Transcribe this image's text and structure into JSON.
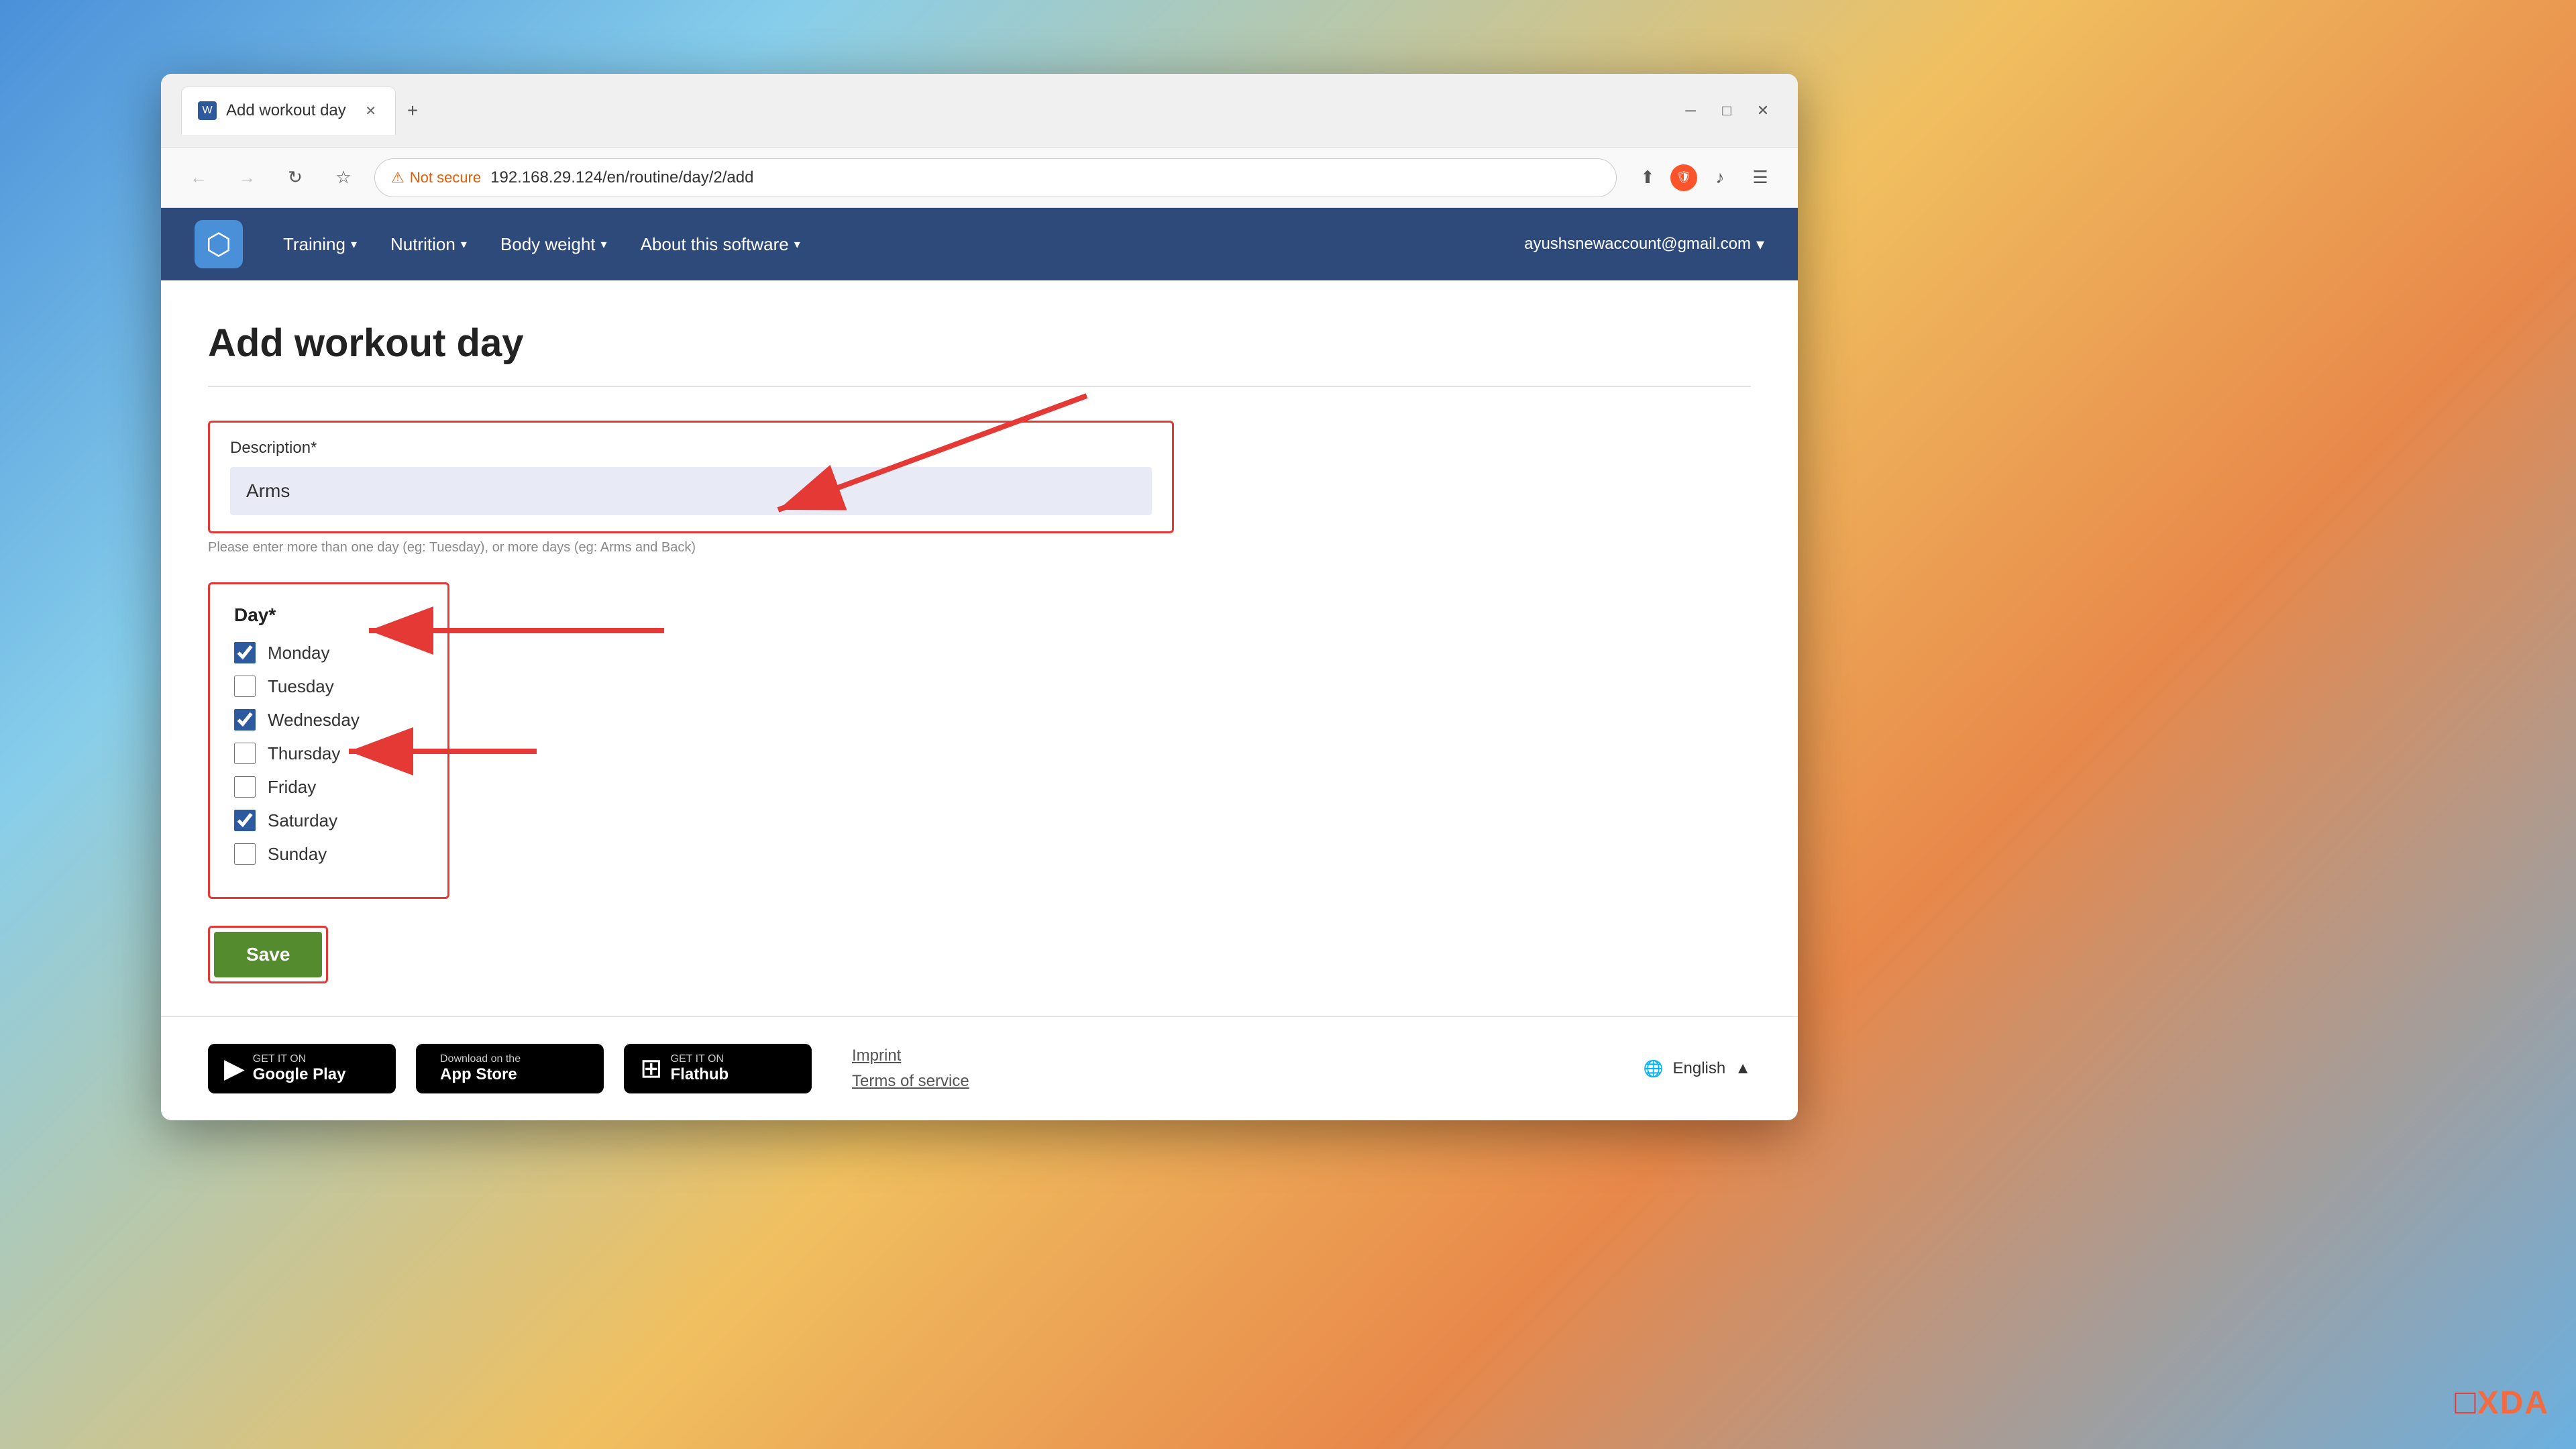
{
  "browser": {
    "tab_title": "Add workout day",
    "tab_favicon": "💪",
    "new_tab_label": "+",
    "address": "192.168.29.124/en/routine/day/2/add",
    "security_label": "Not secure",
    "minimize_label": "─",
    "maximize_label": "□",
    "close_label": "✕",
    "back_label": "←",
    "forward_label": "→",
    "refresh_label": "↻",
    "bookmark_label": "☆",
    "share_label": "⬆",
    "music_label": "♪",
    "menu_label": "☰"
  },
  "navbar": {
    "logo_icon": "⬡",
    "training_label": "Training",
    "nutrition_label": "Nutrition",
    "body_weight_label": "Body weight",
    "about_label": "About this software",
    "user_email": "ayushsnewaccount@gmail.com",
    "dropdown_arrow": "▾"
  },
  "page": {
    "title": "Add workout day",
    "description_label": "Description*",
    "description_value": "Arms",
    "description_hint": "Please enter more than one day (eg: Tuesday), or more days (eg: Arms and Back)",
    "day_label": "Day*",
    "days": [
      {
        "name": "Monday",
        "checked": true
      },
      {
        "name": "Tuesday",
        "checked": false
      },
      {
        "name": "Wednesday",
        "checked": true
      },
      {
        "name": "Thursday",
        "checked": false
      },
      {
        "name": "Friday",
        "checked": false
      },
      {
        "name": "Saturday",
        "checked": true
      },
      {
        "name": "Sunday",
        "checked": false
      }
    ],
    "save_label": "Save"
  },
  "footer": {
    "google_play_sub": "GET IT ON",
    "google_play_main": "Google Play",
    "app_store_sub": "Download on the",
    "app_store_main": "App Store",
    "flathub_sub": "GET IT ON",
    "flathub_main": "Flathub",
    "imprint_label": "Imprint",
    "terms_label": "Terms of service",
    "language_label": "English",
    "language_arrow": "▲"
  }
}
